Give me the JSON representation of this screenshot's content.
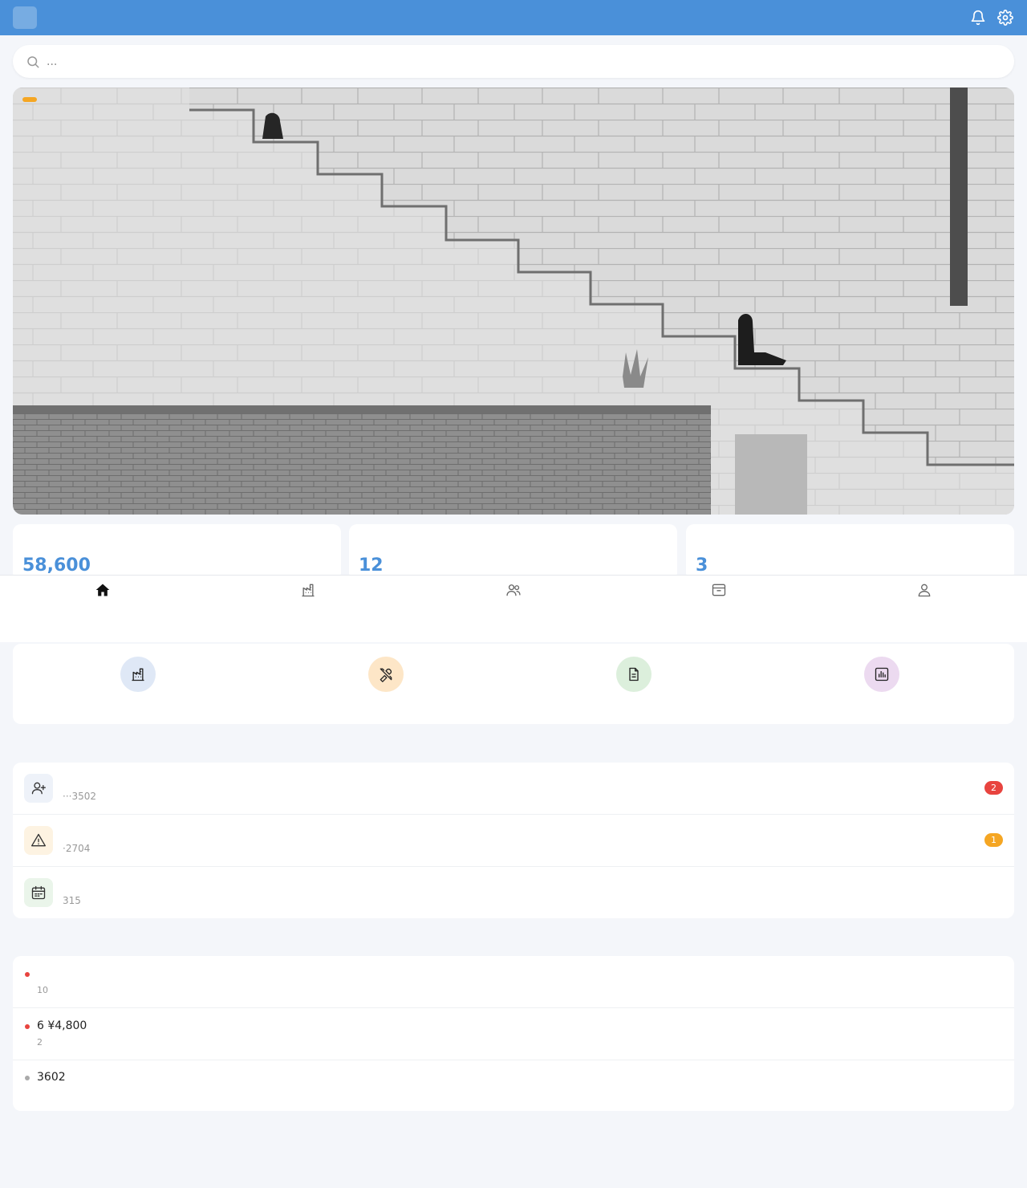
{
  "header": {
    "logo": "",
    "title": "",
    "bell_icon": "bell-icon",
    "settings_icon": "gear-icon"
  },
  "search": {
    "placeholder": "..."
  },
  "banner": {
    "tag": ""
  },
  "stats": [
    {
      "label": "",
      "value": "58,600",
      "unit": ""
    },
    {
      "label": "",
      "value": "12",
      "unit": ""
    },
    {
      "label": "",
      "value": "3",
      "unit": ""
    }
  ],
  "tabbar": {
    "items": [
      {
        "label": "",
        "icon": "home-icon",
        "active": true
      },
      {
        "label": "",
        "icon": "building-icon",
        "active": false
      },
      {
        "label": "",
        "icon": "users-icon",
        "active": false
      },
      {
        "label": "",
        "icon": "inbox-icon",
        "active": false
      },
      {
        "label": "",
        "icon": "user-icon",
        "active": false
      }
    ]
  },
  "shortcuts": [
    {
      "label": "",
      "icon": "building-icon",
      "color": "#dfe8f6"
    },
    {
      "label": "",
      "icon": "tools-icon",
      "color": "#fde6c7"
    },
    {
      "label": "",
      "icon": "document-icon",
      "color": "#dcefdc"
    },
    {
      "label": "",
      "icon": "chart-icon",
      "color": "#ecdaf0"
    }
  ],
  "todos": {
    "title": "",
    "link": "",
    "items": [
      {
        "title": "",
        "subtitle": " ···3502",
        "badge": "2",
        "badge_color": "#e8443f",
        "icon": "user-plus-icon",
        "icon_bg": "#eef2f9"
      },
      {
        "title": "",
        "subtitle": "·2704",
        "badge": "1",
        "badge_color": "#f5a623",
        "icon": "warning-icon",
        "icon_bg": "#fdf3e2"
      },
      {
        "title": "",
        "subtitle": "315",
        "badge": "",
        "badge_color": "",
        "icon": "calendar-icon",
        "icon_bg": "#eaf5ea"
      }
    ]
  },
  "notices": {
    "title": "",
    "link": "",
    "items": [
      {
        "title": "",
        "time": "10",
        "dot_color": "#e8443f"
      },
      {
        "title": "6 ¥4,800",
        "time": "2",
        "dot_color": "#e8443f"
      },
      {
        "title": "3602",
        "time": "",
        "dot_color": "#aaaaaa"
      }
    ]
  }
}
